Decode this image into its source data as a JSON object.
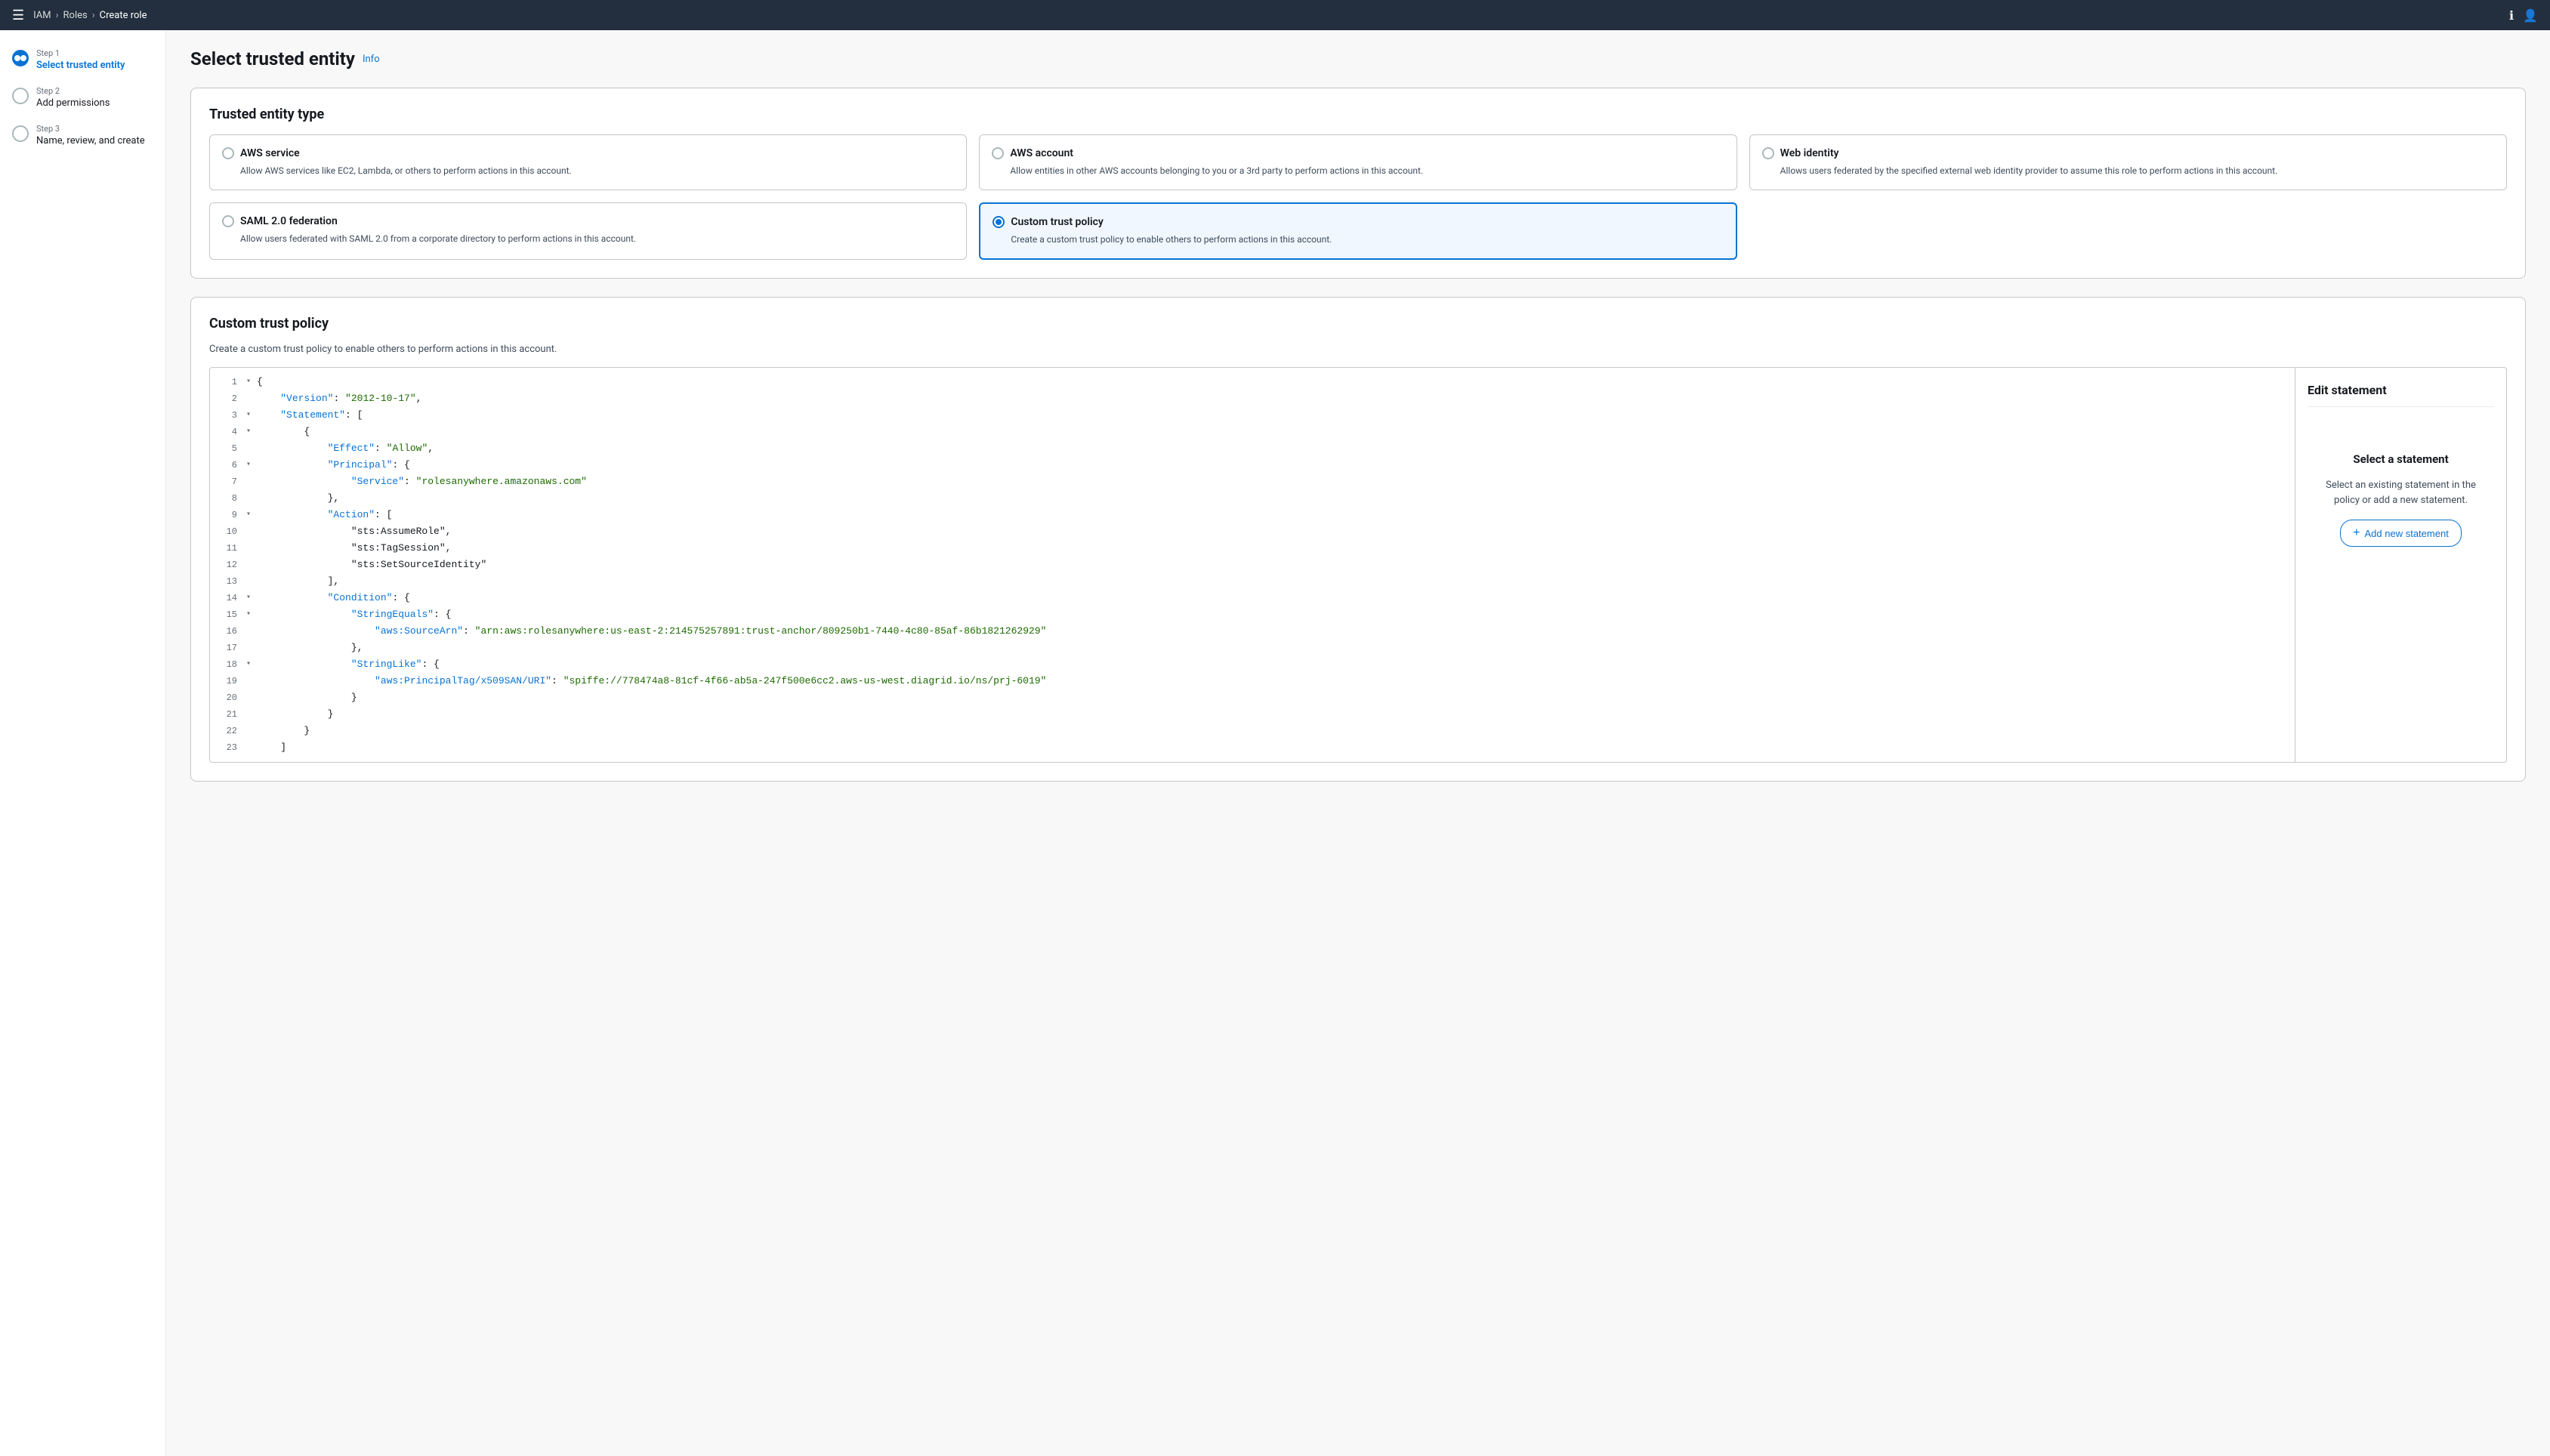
{
  "nav": {
    "hamburger": "☰",
    "breadcrumbs": [
      {
        "label": "IAM",
        "link": true
      },
      {
        "label": "Roles",
        "link": true
      },
      {
        "label": "Create role",
        "link": false
      }
    ],
    "info_icon": "ℹ",
    "account_icon": "👤"
  },
  "sidebar": {
    "steps": [
      {
        "step_label": "Step 1",
        "step_title": "Select trusted entity",
        "active": true
      },
      {
        "step_label": "Step 2",
        "step_title": "Add permissions",
        "active": false
      },
      {
        "step_label": "Step 3",
        "step_title": "Name, review, and create",
        "active": false
      }
    ]
  },
  "page": {
    "title": "Select trusted entity",
    "info_link": "Info"
  },
  "trusted_entity": {
    "section_title": "Trusted entity type",
    "options": [
      {
        "id": "aws-service",
        "name": "AWS service",
        "description": "Allow AWS services like EC2, Lambda, or others to perform actions in this account.",
        "selected": false
      },
      {
        "id": "aws-account",
        "name": "AWS account",
        "description": "Allow entities in other AWS accounts belonging to you or a 3rd party to perform actions in this account.",
        "selected": false
      },
      {
        "id": "web-identity",
        "name": "Web identity",
        "description": "Allows users federated by the specified external web identity provider to assume this role to perform actions in this account.",
        "selected": false
      },
      {
        "id": "saml-federation",
        "name": "SAML 2.0 federation",
        "description": "Allow users federated with SAML 2.0 from a corporate directory to perform actions in this account.",
        "selected": false
      },
      {
        "id": "custom-trust-policy",
        "name": "Custom trust policy",
        "description": "Create a custom trust policy to enable others to perform actions in this account.",
        "selected": true
      }
    ]
  },
  "custom_policy": {
    "section_title": "Custom trust policy",
    "subtitle": "Create a custom trust policy to enable others to perform actions in this account.",
    "code_lines": [
      {
        "num": 1,
        "toggle": "▾",
        "content": "{"
      },
      {
        "num": 2,
        "toggle": "",
        "content": "    \"Version\": \"2012-10-17\","
      },
      {
        "num": 3,
        "toggle": "▾",
        "content": "    \"Statement\": ["
      },
      {
        "num": 4,
        "toggle": "▾",
        "content": "        {"
      },
      {
        "num": 5,
        "toggle": "",
        "content": "            \"Effect\": \"Allow\","
      },
      {
        "num": 6,
        "toggle": "▾",
        "content": "            \"Principal\": {"
      },
      {
        "num": 7,
        "toggle": "",
        "content": "                \"Service\": \"rolesanywhere.amazonaws.com\""
      },
      {
        "num": 8,
        "toggle": "",
        "content": "            },"
      },
      {
        "num": 9,
        "toggle": "▾",
        "content": "            \"Action\": ["
      },
      {
        "num": 10,
        "toggle": "",
        "content": "                \"sts:AssumeRole\","
      },
      {
        "num": 11,
        "toggle": "",
        "content": "                \"sts:TagSession\","
      },
      {
        "num": 12,
        "toggle": "",
        "content": "                \"sts:SetSourceIdentity\""
      },
      {
        "num": 13,
        "toggle": "",
        "content": "            ],"
      },
      {
        "num": 14,
        "toggle": "▾",
        "content": "            \"Condition\": {"
      },
      {
        "num": 15,
        "toggle": "▾",
        "content": "                \"StringEquals\": {"
      },
      {
        "num": 16,
        "toggle": "",
        "content": "                    \"aws:SourceArn\": \"arn:aws:rolesanywhere:us-east-2:214575257891:trust-anchor/809250b1-7440-4c80-85af-86b1821262929\""
      },
      {
        "num": 17,
        "toggle": "",
        "content": "                },"
      },
      {
        "num": 18,
        "toggle": "▾",
        "content": "                \"StringLike\": {"
      },
      {
        "num": 19,
        "toggle": "",
        "content": "                    \"aws:PrincipalTag/x509SAN/URI\": \"spiffe://778474a8-81cf-4f66-ab5a-247f500e6cc2.aws-us-west.diagrid.io/ns/prj-6019\""
      },
      {
        "num": 20,
        "toggle": "",
        "content": "                }"
      },
      {
        "num": 21,
        "toggle": "",
        "content": "            }"
      },
      {
        "num": 22,
        "toggle": "",
        "content": "        }"
      },
      {
        "num": 23,
        "toggle": "",
        "content": "    ]"
      }
    ]
  },
  "edit_panel": {
    "title": "Edit statement",
    "select_title": "Select a statement",
    "select_desc": "Select an existing statement in the policy or add a new statement.",
    "add_button": "Add new statement"
  }
}
